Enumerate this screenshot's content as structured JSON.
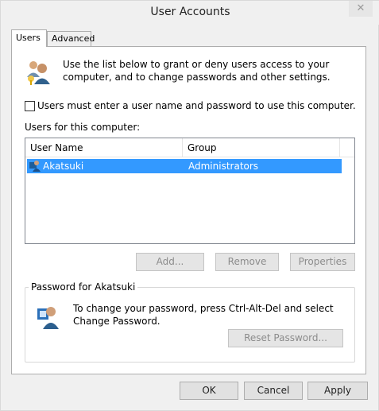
{
  "window": {
    "title": "User Accounts",
    "close_glyph": "✕"
  },
  "tabs": [
    {
      "label": "Users"
    },
    {
      "label": "Advanced"
    }
  ],
  "users_panel": {
    "intro_text": "Use the list below to grant or deny users access to your computer, and to change passwords and other settings.",
    "checkbox_label": "Users must enter a user name and password to use this computer.",
    "checkbox_checked": false,
    "list_label": "Users for this computer:",
    "columns": [
      "User Name",
      "Group"
    ],
    "rows": [
      {
        "name": "Akatsuki",
        "group": "Administrators",
        "selected": true
      }
    ],
    "buttons": {
      "add": "Add...",
      "remove": "Remove",
      "properties": "Properties"
    }
  },
  "password_group": {
    "legend": "Password for Akatsuki",
    "text": "To change your password, press Ctrl-Alt-Del and select Change Password.",
    "reset_button": "Reset Password..."
  },
  "dialog_buttons": {
    "ok": "OK",
    "cancel": "Cancel",
    "apply": "Apply"
  },
  "colors": {
    "selection": "#3399ff",
    "window_bg": "#f0f0f0"
  }
}
